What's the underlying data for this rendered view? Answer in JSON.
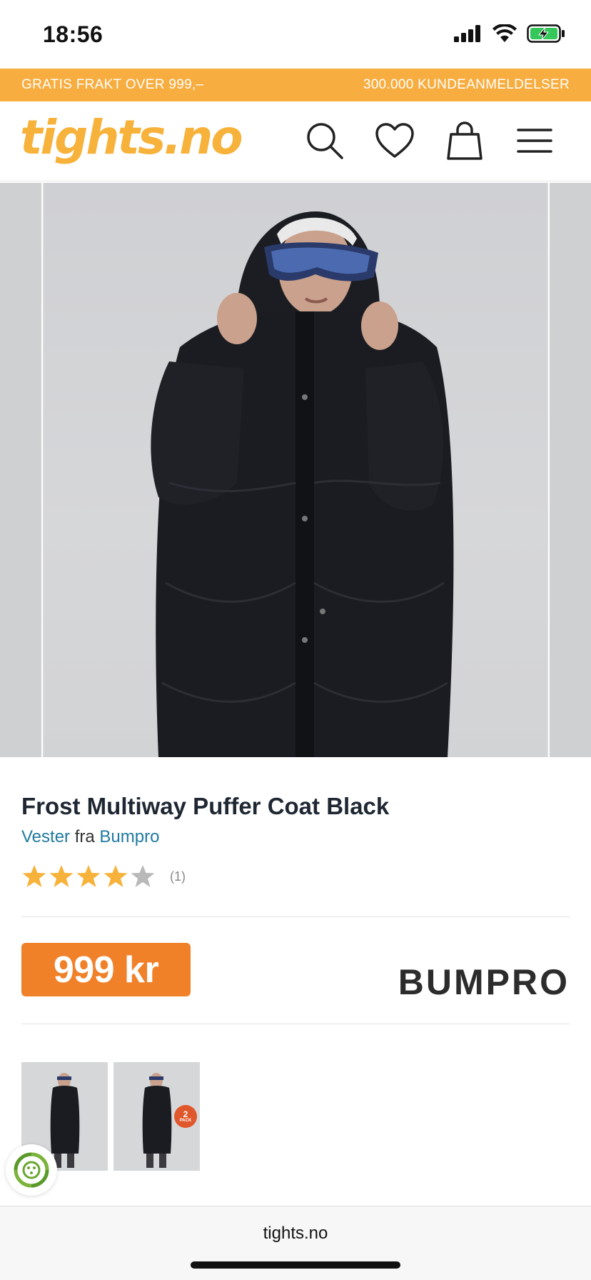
{
  "status_bar": {
    "time": "18:56"
  },
  "promo_bar": {
    "left_text": "GRATIS FRAKT OVER 999,–",
    "right_text": "300.000 KUNDEANMELDELSER"
  },
  "header": {
    "logo": "tights.no",
    "icons": [
      "search-icon",
      "heart-icon",
      "shopping-bag-icon",
      "menu-icon"
    ]
  },
  "product": {
    "title": "Frost Multiway Puffer Coat Black",
    "category": "Vester",
    "from_word": "fra",
    "brand_link": "Bumpro",
    "rating": {
      "stars": 4,
      "max": 5,
      "count": "(1)"
    },
    "price": "999 kr",
    "brand_logo": "BUMPRO"
  },
  "thumbnails": [
    {
      "badge": ""
    },
    {
      "badge": "2",
      "badge_sub": "PACK"
    }
  ],
  "browser": {
    "url": "tights.no"
  },
  "colors": {
    "promo_bar": "#f7ad3f",
    "logo": "#f7b23b",
    "price_badge": "#f08129",
    "link": "#1f7aa0",
    "star_filled": "#f7b23b",
    "star_empty": "#b9b9b9"
  }
}
